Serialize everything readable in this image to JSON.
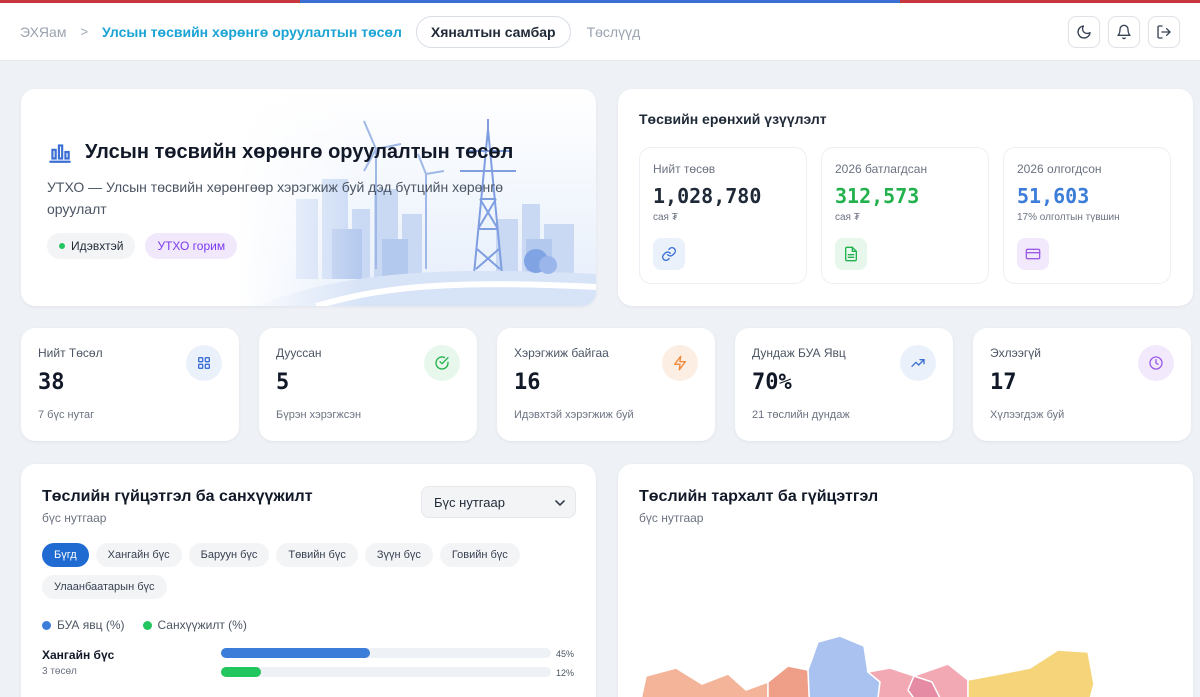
{
  "colors": {
    "stripe": [
      "#c7353f",
      "#3b6fd3",
      "#3b6fd3",
      "#c7353f"
    ],
    "accent": "#1f6bd1"
  },
  "breadcrumb": {
    "home": "ЭХЯам",
    "current": "Улсын төсвийн хөрөнгө оруулалтын төсөл"
  },
  "nav": {
    "active": "Хяналтын самбар",
    "other": "Төслүүд"
  },
  "top_actions": [
    "moon-icon",
    "bell-icon",
    "logout-icon"
  ],
  "hero": {
    "title": "Улсын төсвийн хөрөнгө оруулалтын төсөл",
    "subtitle": "УТХО — Улсын төсвийн хөрөнгөөр хэрэгжиж буй дэд бүтцийн хөрөнгө оруулалт",
    "badge_status": "Идэвхтэй",
    "badge_mode": "УТХО горим"
  },
  "budget": {
    "title": "Төсвийн ерөнхий үзүүлэлт",
    "cards": [
      {
        "label": "Нийт төсөв",
        "value": "1,028,780",
        "unit": "сая ₮",
        "color": "#1f2937",
        "icon": "link-icon",
        "icon_bg": "#eaf1fb",
        "icon_color": "#3b6fd3"
      },
      {
        "label": "2026 батлагдсан",
        "value": "312,573",
        "unit": "сая ₮",
        "color": "#22b14c",
        "icon": "document-icon",
        "icon_bg": "#e7f7ec",
        "icon_color": "#22b14c"
      },
      {
        "label": "2026 олгогдсон",
        "value": "51,603",
        "unit": "17% олголтын түвшин",
        "color": "#3b7dd8",
        "icon": "card-icon",
        "icon_bg": "#f2e9fc",
        "icon_color": "#9b5de5"
      }
    ]
  },
  "stats": [
    {
      "label": "Нийт Төсөл",
      "value": "38",
      "sub": "7 бүс нутаг",
      "icon": "grid-icon",
      "icon_bg": "#eaf1fb",
      "icon_color": "#3b6fd3"
    },
    {
      "label": "Дууссан",
      "value": "5",
      "sub": "Бүрэн хэрэгжсэн",
      "icon": "check-circle-icon",
      "icon_bg": "#e7f7ec",
      "icon_color": "#22b14c"
    },
    {
      "label": "Хэрэгжиж байгаа",
      "value": "16",
      "sub": "Идэвхтэй хэрэгжиж буй",
      "icon": "lightning-icon",
      "icon_bg": "#fdeee3",
      "icon_color": "#f08a3c"
    },
    {
      "label": "Дундаж БУА Явц",
      "value": "70%",
      "sub": "21 төслийн дундаж",
      "icon": "trend-up-icon",
      "icon_bg": "#eaf1fb",
      "icon_color": "#3b6fd3"
    },
    {
      "label": "Эхлээгүй",
      "value": "17",
      "sub": "Хүлээгдэж буй",
      "icon": "clock-icon",
      "icon_bg": "#f2e9fc",
      "icon_color": "#9b5de5"
    }
  ],
  "progress": {
    "title": "Төслийн гүйцэтгэл ба санхүүжилт",
    "subtitle": "бүс нутгаар",
    "select_value": "Бүс нутгаар",
    "chips": [
      "Бүгд",
      "Хангайн бүс",
      "Баруун бүс",
      "Төвийн бүс",
      "Зүүн бүс",
      "Говийн бүс",
      "Улаанбаатарын бүс"
    ],
    "legend": [
      {
        "label": "БУА явц (%)",
        "color": "#3b7dd8"
      },
      {
        "label": "Санхүүжилт (%)",
        "color": "#22c55e"
      }
    ],
    "rows": [
      {
        "name": "Хангайн бүс",
        "count": "3 төсөл",
        "progress": 45,
        "progress_label": "45%",
        "funding": 12,
        "funding_label": "12%"
      }
    ]
  },
  "map": {
    "title": "Төслийн тархалт ба гүйцэтгэл",
    "subtitle": "бүс нутгаар"
  }
}
